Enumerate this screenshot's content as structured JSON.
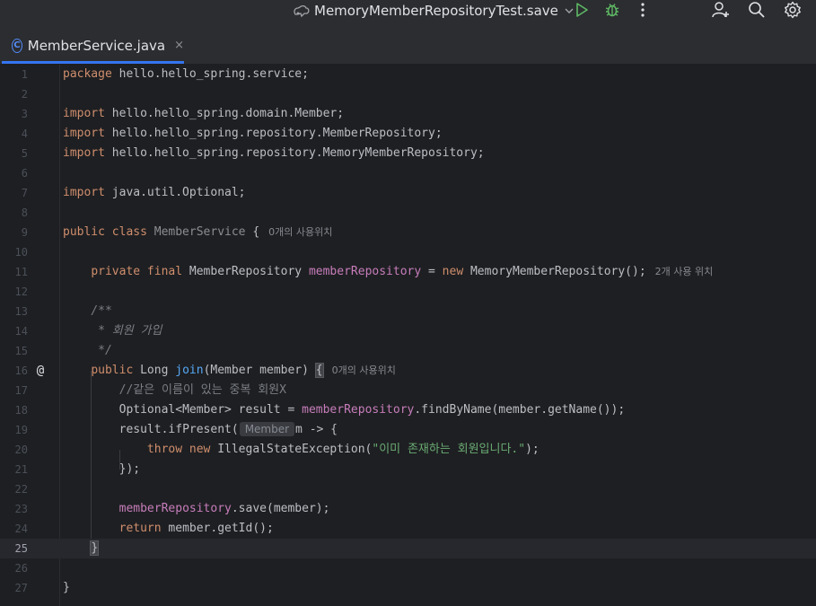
{
  "toolbar": {
    "run_config_label": "MemoryMemberRepositoryTest.save",
    "icons": [
      "run-config-icon",
      "chevron-down-icon",
      "run-icon",
      "debug-icon",
      "more-vert-icon",
      "add-user-icon",
      "search-icon",
      "settings-icon"
    ]
  },
  "tabs": [
    {
      "label": "MemberService.java",
      "icon": "java-class-icon",
      "close": "×"
    }
  ],
  "editor": {
    "lines": [
      {
        "n": "1"
      },
      {
        "n": "2"
      },
      {
        "n": "3"
      },
      {
        "n": "4"
      },
      {
        "n": "5"
      },
      {
        "n": "6"
      },
      {
        "n": "7"
      },
      {
        "n": "8"
      },
      {
        "n": "9"
      },
      {
        "n": "10"
      },
      {
        "n": "11"
      },
      {
        "n": "12"
      },
      {
        "n": "13"
      },
      {
        "n": "14"
      },
      {
        "n": "15"
      },
      {
        "n": "16"
      },
      {
        "n": "17"
      },
      {
        "n": "18"
      },
      {
        "n": "19"
      },
      {
        "n": "20"
      },
      {
        "n": "21"
      },
      {
        "n": "22"
      },
      {
        "n": "23"
      },
      {
        "n": "24"
      },
      {
        "n": "25"
      },
      {
        "n": "26"
      },
      {
        "n": "27"
      }
    ],
    "code": {
      "l1_kw": "package",
      "l1_rest": " hello.hello_spring.service;",
      "l3_kw": "import",
      "l3_rest": " hello.hello_spring.domain.Member;",
      "l4_kw": "import",
      "l4_rest": " hello.hello_spring.repository.MemberRepository;",
      "l5_kw": "import",
      "l5_rest": " hello.hello_spring.repository.MemoryMemberRepository;",
      "l7_kw": "import",
      "l7_rest": " java.util.Optional;",
      "l9_kw": "public class",
      "l9_name": "MemberService",
      "l9_rest": " {",
      "l9_hint": "0개의 사용위치",
      "l11_kw": "private final",
      "l11_type": " MemberRepository ",
      "l11_field": "memberRepository",
      "l11_eq": " = ",
      "l11_new": "new",
      "l11_rest": " MemoryMemberRepository();",
      "l11_hint": "2개 사용 위치",
      "l13": "/**",
      "l14": " * 회원 가입",
      "l15": " */",
      "l16_kw": "public",
      "l16_type": " Long ",
      "l16_fn": "join",
      "l16_rest": "(Member member) ",
      "l16_brace": "{",
      "l16_hint": "0개의 사용위치",
      "l17": "//같은 이름이 있는 중복 회원X",
      "l18_a": "Optional<Member> result = ",
      "l18_field": "memberRepository",
      "l18_b": ".findByName(member.getName());",
      "l19_a": "result.ifPresent(",
      "l19_inlay": "Member",
      "l19_b": "m -> {",
      "l20_kw": "throw new",
      "l20_a": " IllegalStateException(",
      "l20_str": "\"이미 존재하는 회원입니다.\"",
      "l20_b": ");",
      "l21": "});",
      "l23_field": "memberRepository",
      "l23_rest": ".save(member);",
      "l24_kw": "return",
      "l24_rest": " member.getId();",
      "l25": "}",
      "l27": "}"
    },
    "current_line": "25",
    "gutter_marker": "@"
  },
  "colors": {
    "background": "#1e1f22",
    "keyword": "#cf8e6d",
    "field": "#c77dbb",
    "string": "#6aab73",
    "comment": "#7a7e85",
    "accent": "#3574f0"
  }
}
